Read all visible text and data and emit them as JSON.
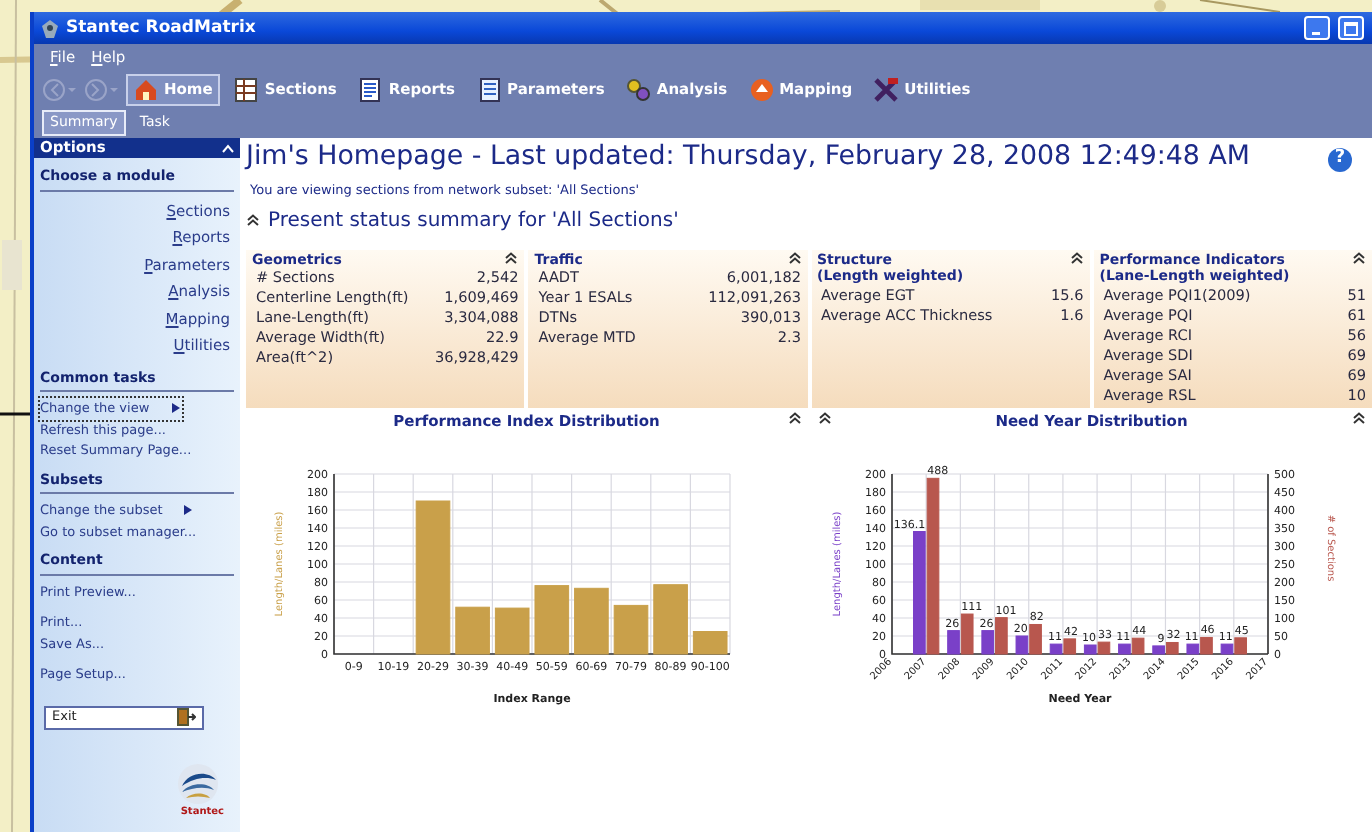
{
  "window": {
    "title": "Stantec RoadMatrix"
  },
  "menu": [
    {
      "label": "File"
    },
    {
      "label": "Help"
    }
  ],
  "history": {
    "back": {
      "disabled": true
    },
    "forward": {
      "disabled": true
    }
  },
  "toolbar": [
    {
      "label": "Home",
      "kind": "home",
      "selected": true
    },
    {
      "label": "Sections",
      "kind": "sections",
      "selected": false
    },
    {
      "label": "Reports",
      "kind": "reports",
      "selected": false
    },
    {
      "label": "Parameters",
      "kind": "parameters",
      "selected": false
    },
    {
      "label": "Analysis",
      "kind": "analysis",
      "selected": false
    },
    {
      "label": "Mapping",
      "kind": "mapping",
      "selected": false
    },
    {
      "label": "Utilities",
      "kind": "utilities",
      "selected": false
    }
  ],
  "view_tabs": [
    {
      "label": "Summary",
      "selected": true
    },
    {
      "label": "Task",
      "selected": false
    }
  ],
  "sidebar": {
    "title": "Options",
    "sections": [
      {
        "heading": "Choose a module",
        "kind": "modules",
        "items": [
          {
            "label": "Sections"
          },
          {
            "label": "Reports"
          },
          {
            "label": "Parameters"
          },
          {
            "label": "Analysis"
          },
          {
            "label": "Mapping"
          },
          {
            "label": "Utilities"
          }
        ]
      },
      {
        "heading": "Common tasks",
        "kind": "tasks",
        "groups": [
          {
            "items": [
              {
                "label": "Change the view",
                "submenu": true,
                "focused": true
              },
              {
                "label": "Refresh this page...",
                "submenu": false,
                "focused": false
              },
              {
                "label": "Reset Summary Page...",
                "submenu": false,
                "focused": false
              }
            ]
          }
        ]
      },
      {
        "heading": "Subsets",
        "kind": "tasks",
        "groups": [
          {
            "items": [
              {
                "label": "Change the subset",
                "submenu": true,
                "focused": false
              },
              {
                "label": "Go to subset manager...",
                "submenu": false,
                "focused": false
              }
            ]
          }
        ]
      },
      {
        "heading": "Content",
        "kind": "tasks",
        "groups": [
          {
            "items": [
              {
                "label": "Print Preview...",
                "submenu": false,
                "focused": false
              }
            ]
          },
          {
            "items": [
              {
                "label": "Print...",
                "submenu": false,
                "focused": false
              },
              {
                "label": "Save As...",
                "submenu": false,
                "focused": false
              }
            ]
          },
          {
            "items": [
              {
                "label": "Page Setup...",
                "submenu": false,
                "focused": false
              }
            ]
          }
        ]
      }
    ],
    "exit_button": "Exit",
    "logo_text": "Stantec"
  },
  "main": {
    "title": "Jim's Homepage - Last updated: Thursday, February 28, 2008  12:49:48 AM",
    "help": "?",
    "subtitle": "You are viewing sections from network subset: 'All Sections'",
    "section_title": "Present status summary for 'All Sections'",
    "panels": [
      {
        "title": "Geometrics",
        "rows": [
          {
            "label": "# Sections",
            "value": "2,542"
          },
          {
            "label": "Centerline Length(ft)",
            "value": "1,609,469"
          },
          {
            "label": "Lane-Length(ft)",
            "value": "3,304,088"
          },
          {
            "label": "Average Width(ft)",
            "value": "22.9"
          },
          {
            "label": "Area(ft^2)",
            "value": "36,928,429"
          }
        ]
      },
      {
        "title": "Traffic",
        "rows": [
          {
            "label": "AADT",
            "value": "6,001,182"
          },
          {
            "label": "Year 1 ESALs",
            "value": "112,091,263"
          },
          {
            "label": "DTNs",
            "value": "390,013"
          },
          {
            "label": "Average MTD",
            "value": "2.3"
          }
        ]
      },
      {
        "title": "Structure\n(Length weighted)",
        "rows": [
          {
            "label": "Average EGT",
            "value": "15.6"
          },
          {
            "label": "Average ACC Thickness",
            "value": "1.6"
          }
        ]
      },
      {
        "title": "Performance Indicators\n(Lane-Length weighted)",
        "rows": [
          {
            "label": "Average PQI1(2009)",
            "value": "51"
          },
          {
            "label": "Average PQI",
            "value": "61"
          },
          {
            "label": "Average RCI",
            "value": "56"
          },
          {
            "label": "Average SDI",
            "value": "69"
          },
          {
            "label": "Average SAI",
            "value": "69"
          },
          {
            "label": "Average RSL",
            "value": "10"
          }
        ]
      }
    ],
    "charts": [
      {
        "chart_data": {
          "type": "bar",
          "title": "Performance Index Distribution",
          "xlabel": "Index Range",
          "grid": true,
          "categories": [
            "0-9",
            "10-19",
            "20-29",
            "30-39",
            "40-49",
            "50-59",
            "60-69",
            "70-79",
            "80-89",
            "90-100"
          ],
          "series": [
            {
              "name": "Length/Lanes (miles)",
              "color": "#c9a04a",
              "values": [
                0,
                0,
                170,
                52,
                51,
                76,
                73,
                54,
                77,
                25
              ]
            }
          ],
          "ylim": [
            0,
            200
          ],
          "yticks": [
            0,
            20,
            40,
            60,
            80,
            100,
            120,
            140,
            160,
            180,
            200
          ]
        }
      },
      {
        "chart_data": {
          "type": "bar",
          "title": "Need Year Distribution",
          "xlabel": "Need Year",
          "grid": true,
          "stacked": false,
          "x": [
            2007,
            2008,
            2009,
            2010,
            2011,
            2012,
            2013,
            2014,
            2015,
            2016
          ],
          "xlim": [
            2006,
            2017
          ],
          "xticks": [
            2006,
            2007,
            2008,
            2009,
            2010,
            2011,
            2012,
            2013,
            2014,
            2015,
            2016,
            2017
          ],
          "ylim": [
            0,
            200
          ],
          "yticks": [
            0,
            20,
            40,
            60,
            80,
            100,
            120,
            140,
            160,
            180,
            200
          ],
          "y2lim": [
            0,
            500
          ],
          "y2ticks": [
            0,
            50,
            100,
            150,
            200,
            250,
            300,
            350,
            400,
            450,
            500
          ],
          "data_labels": true,
          "series": [
            {
              "name": "Length/Lanes (miles)",
              "color": "#7a40c8",
              "values": [
                136.1,
                26,
                26,
                20,
                11,
                10,
                11,
                9,
                11,
                11
              ]
            },
            {
              "name": "# of Sections",
              "color": "#b8574e",
              "axis": "y2",
              "values": [
                488,
                111,
                101,
                82,
                42,
                33,
                44,
                32,
                46,
                45
              ]
            }
          ]
        }
      }
    ]
  }
}
